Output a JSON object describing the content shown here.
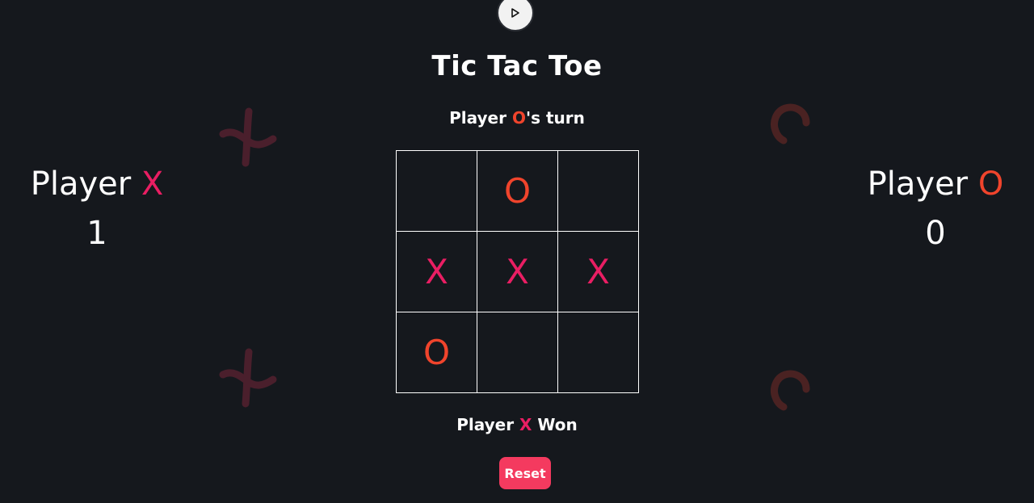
{
  "title": "Tic Tac Toe",
  "turn": {
    "prefix": "Player ",
    "mark": "O",
    "suffix": "'s turn"
  },
  "result": {
    "prefix": "Player ",
    "mark": "X",
    "suffix": " Won"
  },
  "scores": {
    "x": {
      "label": "Player ",
      "mark": "X",
      "value": "1"
    },
    "o": {
      "label": "Player ",
      "mark": "O",
      "value": "0"
    }
  },
  "board": {
    "cells": [
      "",
      "O",
      "",
      "X",
      "X",
      "X",
      "O",
      "",
      ""
    ]
  },
  "reset_label": "Reset",
  "icons": {
    "play": "play-icon",
    "decor_x": "x-decoration-icon",
    "decor_o": "o-decoration-icon"
  },
  "colors": {
    "background": "#15181d",
    "x_mark": "#e91e63",
    "o_mark": "#f0442c",
    "reset_button": "#f43a5f",
    "decor_x": "#4a1f2c",
    "decor_o": "#4a2222"
  }
}
